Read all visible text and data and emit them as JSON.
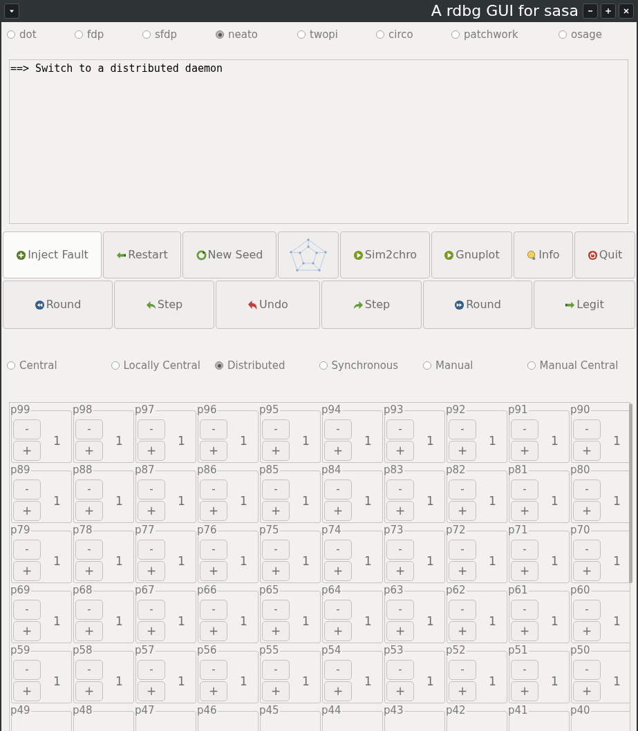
{
  "window": {
    "title": "A rdbg GUI for sasa"
  },
  "layouts": [
    {
      "label": "dot",
      "selected": false
    },
    {
      "label": "fdp",
      "selected": false
    },
    {
      "label": "sfdp",
      "selected": false
    },
    {
      "label": "neato",
      "selected": true
    },
    {
      "label": "twopi",
      "selected": false
    },
    {
      "label": "circo",
      "selected": false
    },
    {
      "label": "patchwork",
      "selected": false
    },
    {
      "label": "osage",
      "selected": false
    }
  ],
  "console": {
    "text": "==> Switch to a distributed daemon"
  },
  "toolbar": [
    {
      "kind": "plus",
      "label": "Inject Fault",
      "hovered": true
    },
    {
      "kind": "back",
      "label": "Restart",
      "hovered": false
    },
    {
      "kind": "refresh",
      "label": "New Seed",
      "hovered": false
    },
    {
      "kind": "graph",
      "hovered": false
    },
    {
      "kind": "play",
      "label": "Sim2chro",
      "hovered": false
    },
    {
      "kind": "play",
      "label": "Gnuplot",
      "hovered": false
    },
    {
      "kind": "bulb",
      "label": "Info",
      "hovered": false
    },
    {
      "kind": "power",
      "label": "Quit",
      "hovered": false
    }
  ],
  "steps": [
    {
      "kind": "rewind",
      "label": "Round"
    },
    {
      "kind": "left",
      "label": "Step"
    },
    {
      "kind": "undo",
      "label": "Undo"
    },
    {
      "kind": "right",
      "label": "Step"
    },
    {
      "kind": "forward",
      "label": "Round"
    },
    {
      "kind": "legit",
      "label": "Legit"
    }
  ],
  "daemons": [
    {
      "label": "Central",
      "selected": false
    },
    {
      "label": "Locally Central",
      "selected": false
    },
    {
      "label": "Distributed",
      "selected": true
    },
    {
      "label": "Synchronous",
      "selected": false
    },
    {
      "label": "Manual",
      "selected": false
    },
    {
      "label": "Manual Central",
      "selected": false
    }
  ],
  "processes": [
    [
      {
        "label": "p99",
        "minus": "-",
        "plus": "+",
        "value": "1"
      },
      {
        "label": "p98",
        "minus": "-",
        "plus": "+",
        "value": "1"
      },
      {
        "label": "p97",
        "minus": "-",
        "plus": "+",
        "value": "1"
      },
      {
        "label": "p96",
        "minus": "-",
        "plus": "+",
        "value": "1"
      },
      {
        "label": "p95",
        "minus": "-",
        "plus": "+",
        "value": "1"
      },
      {
        "label": "p94",
        "minus": "-",
        "plus": "+",
        "value": "1"
      },
      {
        "label": "p93",
        "minus": "-",
        "plus": "+",
        "value": "1"
      },
      {
        "label": "p92",
        "minus": "-",
        "plus": "+",
        "value": "1"
      },
      {
        "label": "p91",
        "minus": "-",
        "plus": "+",
        "value": "1"
      },
      {
        "label": "p90",
        "minus": "-",
        "plus": "+",
        "value": "1"
      }
    ],
    [
      {
        "label": "p89",
        "minus": "-",
        "plus": "+",
        "value": "1"
      },
      {
        "label": "p88",
        "minus": "-",
        "plus": "+",
        "value": "1"
      },
      {
        "label": "p87",
        "minus": "-",
        "plus": "+",
        "value": "1"
      },
      {
        "label": "p86",
        "minus": "-",
        "plus": "+",
        "value": "1"
      },
      {
        "label": "p85",
        "minus": "-",
        "plus": "+",
        "value": "1"
      },
      {
        "label": "p84",
        "minus": "-",
        "plus": "+",
        "value": "1"
      },
      {
        "label": "p83",
        "minus": "-",
        "plus": "+",
        "value": "1"
      },
      {
        "label": "p82",
        "minus": "-",
        "plus": "+",
        "value": "1"
      },
      {
        "label": "p81",
        "minus": "-",
        "plus": "+",
        "value": "1"
      },
      {
        "label": "p80",
        "minus": "-",
        "plus": "+",
        "value": "1"
      }
    ],
    [
      {
        "label": "p79",
        "minus": "-",
        "plus": "+",
        "value": "1"
      },
      {
        "label": "p78",
        "minus": "-",
        "plus": "+",
        "value": "1"
      },
      {
        "label": "p77",
        "minus": "-",
        "plus": "+",
        "value": "1"
      },
      {
        "label": "p76",
        "minus": "-",
        "plus": "+",
        "value": "1"
      },
      {
        "label": "p75",
        "minus": "-",
        "plus": "+",
        "value": "1"
      },
      {
        "label": "p74",
        "minus": "-",
        "plus": "+",
        "value": "1"
      },
      {
        "label": "p73",
        "minus": "-",
        "plus": "+",
        "value": "1"
      },
      {
        "label": "p72",
        "minus": "-",
        "plus": "+",
        "value": "1"
      },
      {
        "label": "p71",
        "minus": "-",
        "plus": "+",
        "value": "1"
      },
      {
        "label": "p70",
        "minus": "-",
        "plus": "+",
        "value": "1"
      }
    ],
    [
      {
        "label": "p69",
        "minus": "-",
        "plus": "+",
        "value": "1"
      },
      {
        "label": "p68",
        "minus": "-",
        "plus": "+",
        "value": "1"
      },
      {
        "label": "p67",
        "minus": "-",
        "plus": "+",
        "value": "1"
      },
      {
        "label": "p66",
        "minus": "-",
        "plus": "+",
        "value": "1"
      },
      {
        "label": "p65",
        "minus": "-",
        "plus": "+",
        "value": "1"
      },
      {
        "label": "p64",
        "minus": "-",
        "plus": "+",
        "value": "1"
      },
      {
        "label": "p63",
        "minus": "-",
        "plus": "+",
        "value": "1"
      },
      {
        "label": "p62",
        "minus": "-",
        "plus": "+",
        "value": "1"
      },
      {
        "label": "p61",
        "minus": "-",
        "plus": "+",
        "value": "1"
      },
      {
        "label": "p60",
        "minus": "-",
        "plus": "+",
        "value": "1"
      }
    ],
    [
      {
        "label": "p59",
        "minus": "-",
        "plus": "+",
        "value": "1"
      },
      {
        "label": "p58",
        "minus": "-",
        "plus": "+",
        "value": "1"
      },
      {
        "label": "p57",
        "minus": "-",
        "plus": "+",
        "value": "1"
      },
      {
        "label": "p56",
        "minus": "-",
        "plus": "+",
        "value": "1"
      },
      {
        "label": "p55",
        "minus": "-",
        "plus": "+",
        "value": "1"
      },
      {
        "label": "p54",
        "minus": "-",
        "plus": "+",
        "value": "1"
      },
      {
        "label": "p53",
        "minus": "-",
        "plus": "+",
        "value": "1"
      },
      {
        "label": "p52",
        "minus": "-",
        "plus": "+",
        "value": "1"
      },
      {
        "label": "p51",
        "minus": "-",
        "plus": "+",
        "value": "1"
      },
      {
        "label": "p50",
        "minus": "-",
        "plus": "+",
        "value": "1"
      }
    ],
    [
      {
        "label": "p49"
      },
      {
        "label": "p48"
      },
      {
        "label": "p47"
      },
      {
        "label": "p46"
      },
      {
        "label": "p45"
      },
      {
        "label": "p44"
      },
      {
        "label": "p43"
      },
      {
        "label": "p42"
      },
      {
        "label": "p41"
      },
      {
        "label": "p40"
      }
    ]
  ]
}
